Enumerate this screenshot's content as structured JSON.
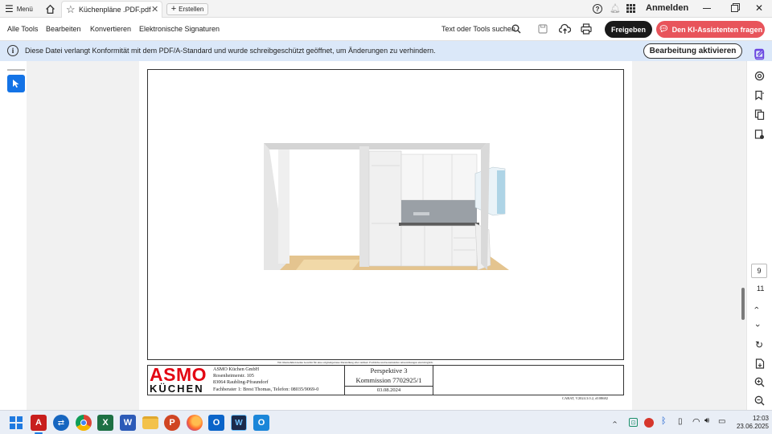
{
  "titlebar": {
    "menu_label": "Menü",
    "tab_title": "Küchenpläne .PDF.pdf",
    "new_tab_label": "Erstellen",
    "signin_label": "Anmelden"
  },
  "toolbar": {
    "items": [
      "Alle Tools",
      "Bearbeiten",
      "Konvertieren",
      "Elektronische Signaturen"
    ],
    "search_label": "Text oder Tools suchen",
    "share_label": "Freigeben",
    "ai_label": "Den KI-Assistenten fragen"
  },
  "banner": {
    "message": "Diese Datei verlangt Konformität mit dem PDF/A-Standard und wurde schreibgeschützt geöffnet, um Änderungen zu verhindern.",
    "enable_editing_label": "Bearbeitung aktivieren"
  },
  "document": {
    "disclaimer": "Wir übernehmen keine Gewähr für eine originalgetreue Darstellung aller Artikel. Farbliche und konstruktive Abweichungen sind möglich.",
    "logo_top": "ASMO",
    "logo_bottom": "KÜCHEN",
    "company_name": "ASMO Küchen GmbH",
    "street": "Rosenheimerstr. 105",
    "city": "83064 Raubling-Pfraundorf",
    "advisor": "Fachberater 1: Brest Thomas, Telefon: 08035/9069-0",
    "perspective": "Perspektive 3",
    "commission": "Kommission 7702925/1",
    "date": "03.08.2024",
    "footer": "CARAT,  V2024.3.0.2,  #108682"
  },
  "page_nav": {
    "current_page": "9",
    "total_pages": "11"
  },
  "system_tray": {
    "time": "12:03",
    "date": "23.06.2025"
  },
  "colors": {
    "accent_blue": "#1473e6",
    "ai_button": "#e8545b",
    "logo_red": "#e30613",
    "banner_bg": "#dbe8f9"
  }
}
